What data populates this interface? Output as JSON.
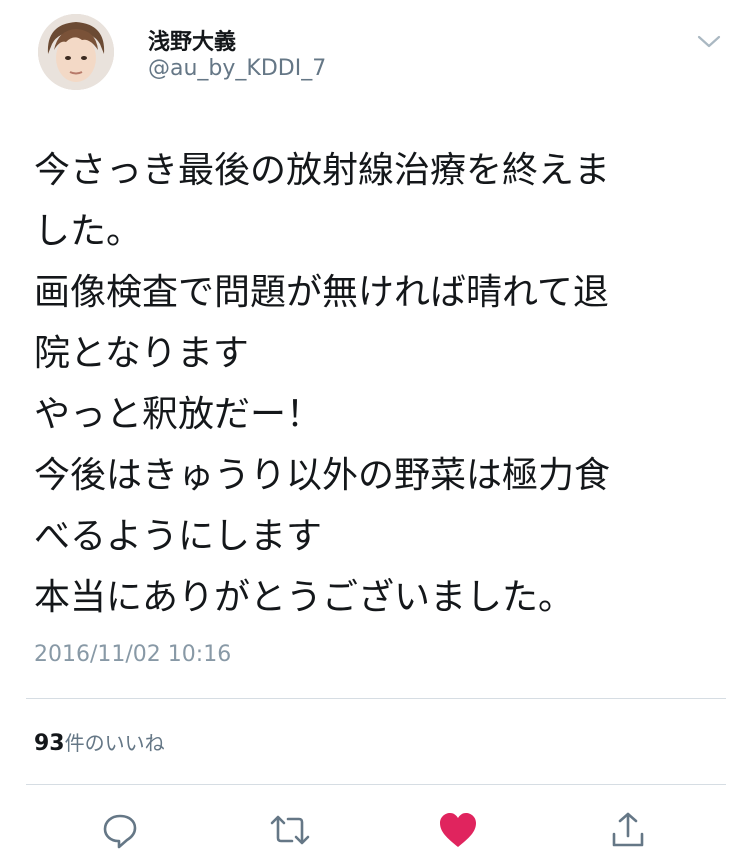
{
  "author": {
    "display_name": "浅野大義",
    "handle": "@au_by_KDDI_7"
  },
  "tweet": {
    "lines": [
      "今さっき最後の放射線治療を終えま",
      "した。",
      "画像検査で問題が無ければ晴れて退",
      "院となります",
      "やっと釈放だー！",
      "今後はきゅうり以外の野菜は極力食",
      "べるようにします",
      "本当にありがとうございました。"
    ],
    "timestamp": "2016/11/02 10:16"
  },
  "stats": {
    "likes_count": "93",
    "likes_label": "件のいいね"
  },
  "actions": {
    "icons": [
      "chevron-down-icon",
      "reply-icon",
      "retweet-icon",
      "heart-icon",
      "share-icon"
    ],
    "like_color": "#e0245e",
    "icon_color": "#657786"
  }
}
